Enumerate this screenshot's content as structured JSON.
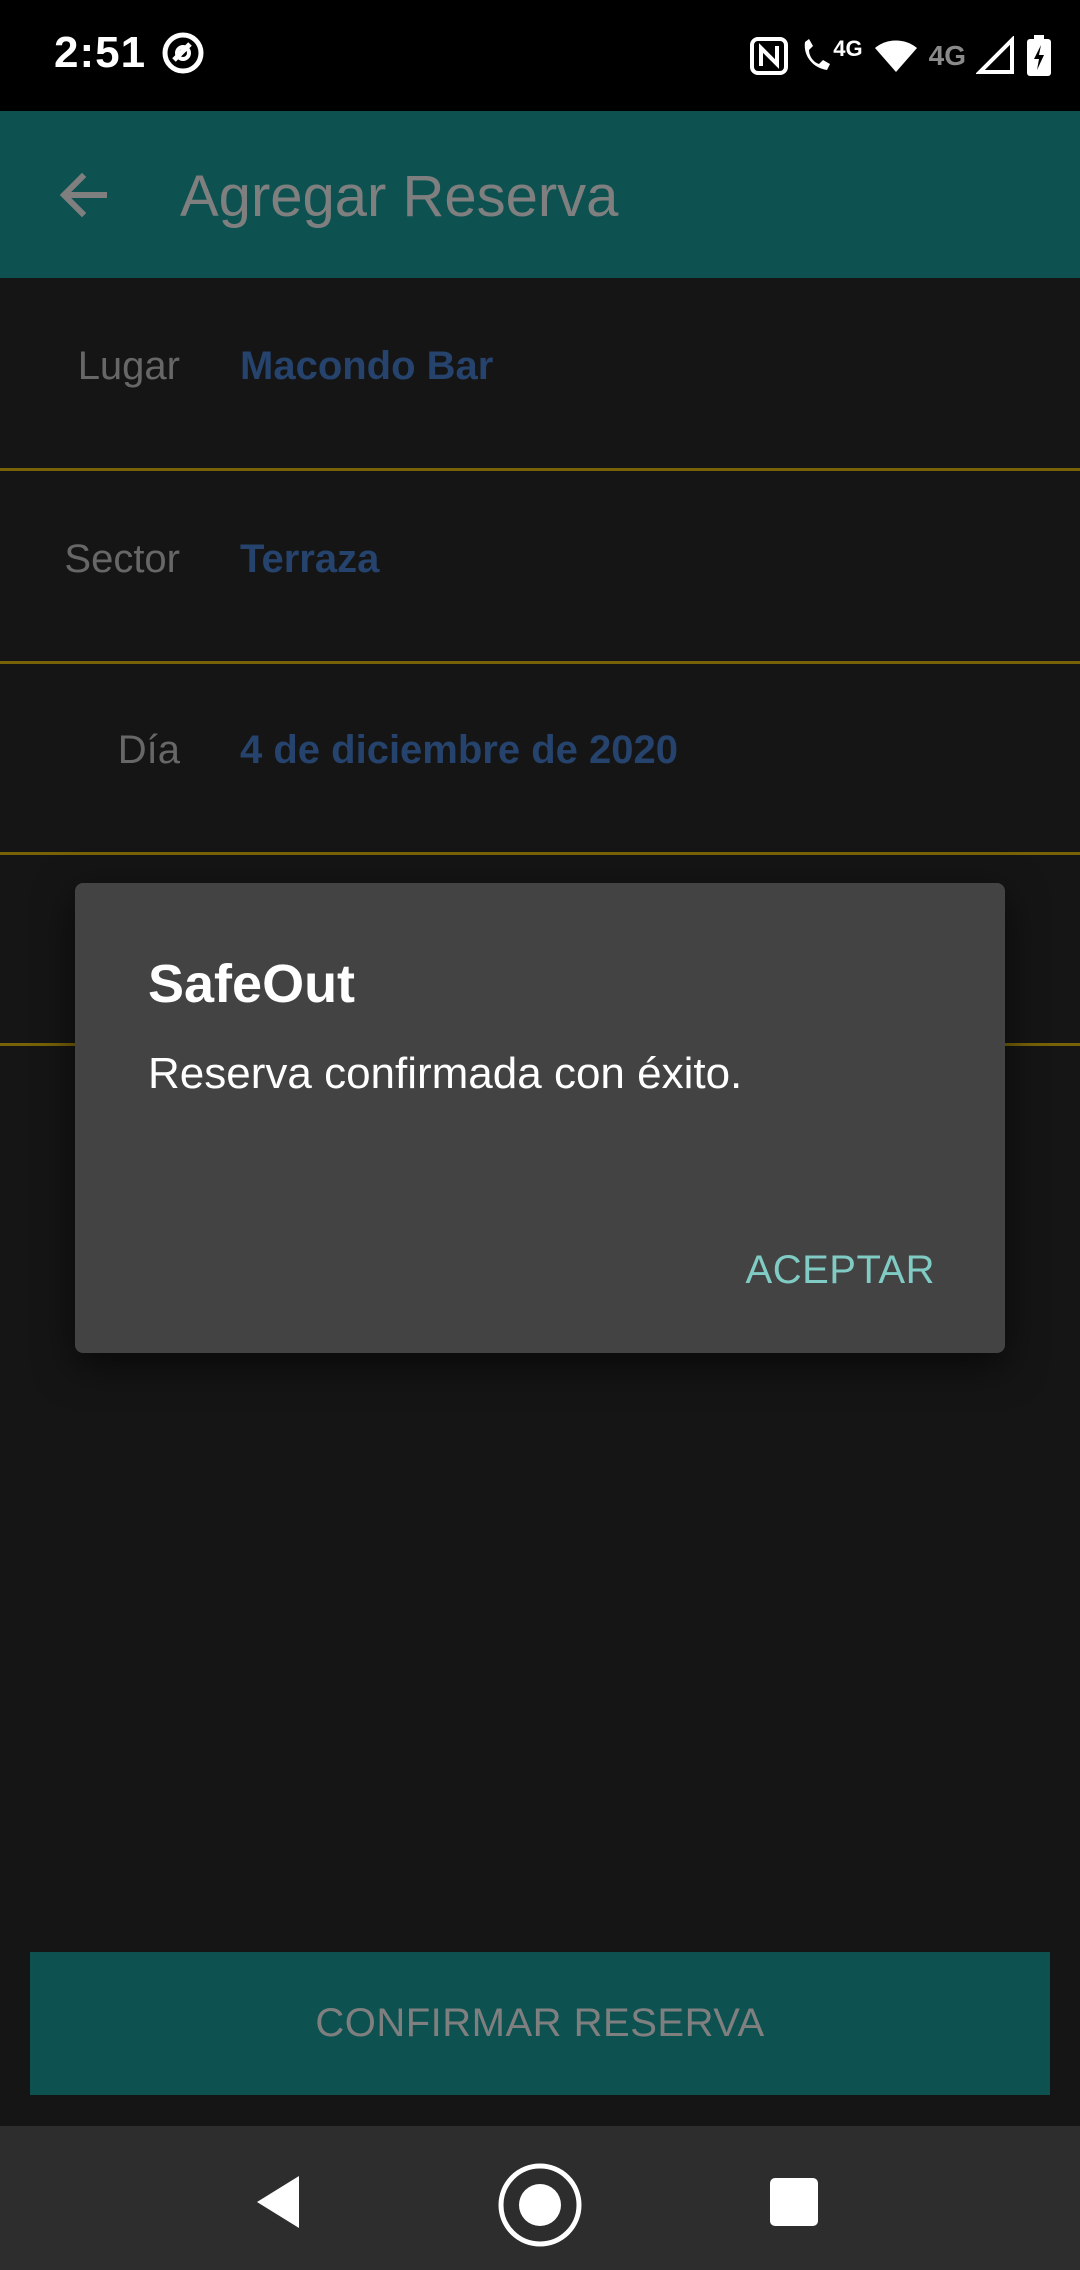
{
  "status_bar": {
    "time": "2:51",
    "network_label_1": "4G",
    "network_label_2": "4G"
  },
  "app_bar": {
    "title": "Agregar Reserva",
    "back_icon": "arrow-left-icon"
  },
  "form": {
    "rows": [
      {
        "label": "Lugar",
        "value": "Macondo Bar"
      },
      {
        "label": "Sector",
        "value": "Terraza"
      },
      {
        "label": "Día",
        "value": "4 de diciembre de 2020"
      },
      {
        "label": "",
        "value": ""
      }
    ]
  },
  "confirm_button": {
    "label": "CONFIRMAR RESERVA"
  },
  "dialog": {
    "title": "SafeOut",
    "message": "Reserva confirmada con éxito.",
    "button": "ACEPTAR"
  },
  "colors": {
    "app_bar": "#1aa3a0",
    "accent_text": "#4a86d8",
    "divider": "#f1c40f",
    "dialog_button": "#80cbc4"
  }
}
